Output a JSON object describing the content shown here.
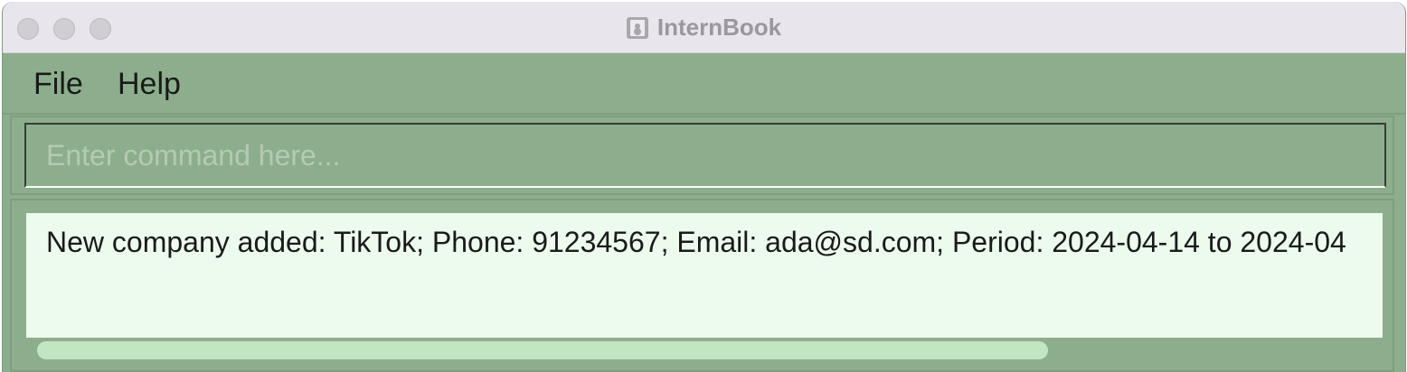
{
  "window": {
    "title": "InternBook",
    "app_icon": "contact-book-icon",
    "traffic_lights": [
      "close",
      "minimize",
      "zoom"
    ]
  },
  "menu": {
    "items": [
      {
        "label": "File"
      },
      {
        "label": "Help"
      }
    ]
  },
  "command_box": {
    "placeholder": "Enter command here...",
    "value": ""
  },
  "result_display": {
    "text": "New company added: TikTok; Phone: 91234567; Email: ada@sd.com; Period: 2024-04-14 to 2024-04"
  },
  "colors": {
    "window_background": "#8cae8c",
    "titlebar": "#e8e6ec",
    "result_background": "#edfbee",
    "scrollbar_thumb": "#c2e6c2"
  }
}
